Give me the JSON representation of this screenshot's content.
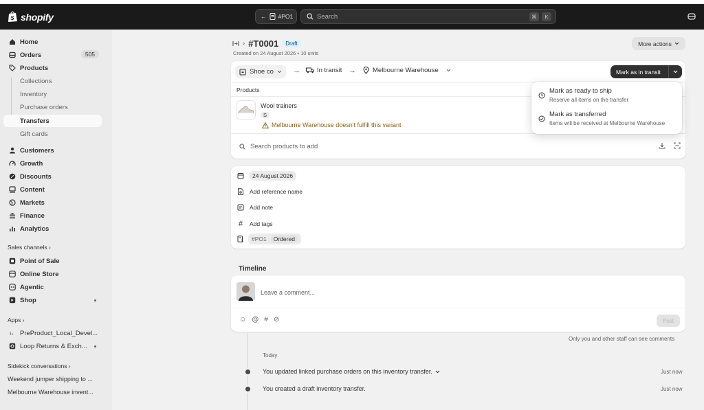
{
  "header": {
    "brand": "shopify",
    "po_pill": "#PO1",
    "search_placeholder": "Search",
    "shortcut_keys": [
      "⌘",
      "K"
    ]
  },
  "sidebar": {
    "items": [
      {
        "label": "Home",
        "icon": "home-icon"
      },
      {
        "label": "Orders",
        "icon": "orders-icon",
        "badge": "505"
      },
      {
        "label": "Products",
        "icon": "tag-icon"
      }
    ],
    "product_sub": [
      "Collections",
      "Inventory",
      "Purchase orders",
      "Transfers",
      "Gift cards"
    ],
    "items2": [
      {
        "label": "Customers",
        "icon": "person-icon"
      },
      {
        "label": "Growth",
        "icon": "gauge-icon"
      },
      {
        "label": "Discounts",
        "icon": "discount-icon"
      },
      {
        "label": "Content",
        "icon": "content-icon"
      },
      {
        "label": "Markets",
        "icon": "globe-icon"
      },
      {
        "label": "Finance",
        "icon": "bank-icon"
      },
      {
        "label": "Analytics",
        "icon": "bar-chart-icon"
      }
    ],
    "sales_channels_label": "Sales channels",
    "channels": [
      {
        "label": "Point of Sale",
        "icon": "pos-icon"
      },
      {
        "label": "Online Store",
        "icon": "store-icon"
      },
      {
        "label": "Agentic",
        "icon": "agentic-icon"
      },
      {
        "label": "Shop",
        "icon": "shop-icon"
      }
    ],
    "apps_label": "Apps",
    "apps": [
      {
        "label": "PreProduct_Local_Devel..."
      },
      {
        "label": "Loop Returns & Exch..."
      }
    ],
    "sidekick_label": "Sidekick conversations",
    "conversations": [
      "Weekend jumper shipping to ...",
      "Melbourne Warehouse invent..."
    ]
  },
  "transfer": {
    "id": "#T0001",
    "status": "Draft",
    "subtitle": "Created on 24 August 2026 • 10 units",
    "more_actions": "More actions",
    "origin": "Shoe co",
    "stage": "In transit",
    "destination": "Melbourne Warehouse",
    "primary_action": "Mark as in transit",
    "products_header": "Products",
    "product": {
      "name": "Wool trainers",
      "variant": "S",
      "warning": "Melbourne Warehouse doesn't fulfill this variant"
    },
    "search_products_placeholder": "Search products to add"
  },
  "dropdown": {
    "items": [
      {
        "title": "Mark as ready to ship",
        "desc": "Reserve all items on the transfer",
        "icon": "clock-icon"
      },
      {
        "title": "Mark as transferred",
        "desc": "Items will be received at Melbourne Warehouse",
        "icon": "check-circle-icon"
      }
    ]
  },
  "details": {
    "date": "24 August 2026",
    "reference": "Add reference name",
    "note": "Add note",
    "tags": "Add tags",
    "po": "#PO1",
    "po_status": "Ordered"
  },
  "timeline": {
    "title": "Timeline",
    "comment_placeholder": "Leave a comment...",
    "post": "Post",
    "visibility_note": "Only you and other staff can see comments",
    "day": "Today",
    "events": [
      {
        "text": "You updated linked purchase orders on this inventory transfer.",
        "time": "Just now"
      },
      {
        "text": "You created a draft inventory transfer.",
        "time": "Just now"
      }
    ]
  },
  "colors": {
    "topbar": "#1a1a1a",
    "sidebar": "#ebebeb",
    "page": "#f1f1f1",
    "draft_badge": "#e0f0ff",
    "warning": "#8a6116"
  }
}
